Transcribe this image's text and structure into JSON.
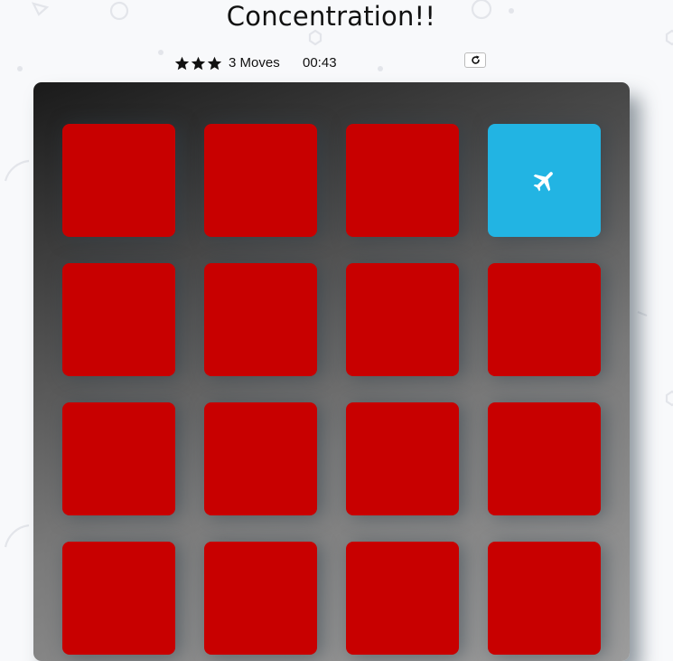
{
  "game": {
    "title": "Concentration!!",
    "stars": [
      "star-icon",
      "star-icon",
      "star-icon"
    ],
    "moves": "3 Moves",
    "timer": "00:43",
    "restart_icon": "repeat-icon"
  },
  "colors": {
    "card_back": "#c80000",
    "card_open": "#22b4e3"
  },
  "deck": {
    "cards": [
      {
        "state": "closed"
      },
      {
        "state": "closed"
      },
      {
        "state": "closed"
      },
      {
        "state": "open",
        "icon": "plane-icon"
      },
      {
        "state": "closed"
      },
      {
        "state": "closed"
      },
      {
        "state": "closed"
      },
      {
        "state": "closed"
      },
      {
        "state": "closed"
      },
      {
        "state": "closed"
      },
      {
        "state": "closed"
      },
      {
        "state": "closed"
      },
      {
        "state": "closed"
      },
      {
        "state": "closed"
      },
      {
        "state": "closed"
      },
      {
        "state": "closed"
      }
    ]
  }
}
